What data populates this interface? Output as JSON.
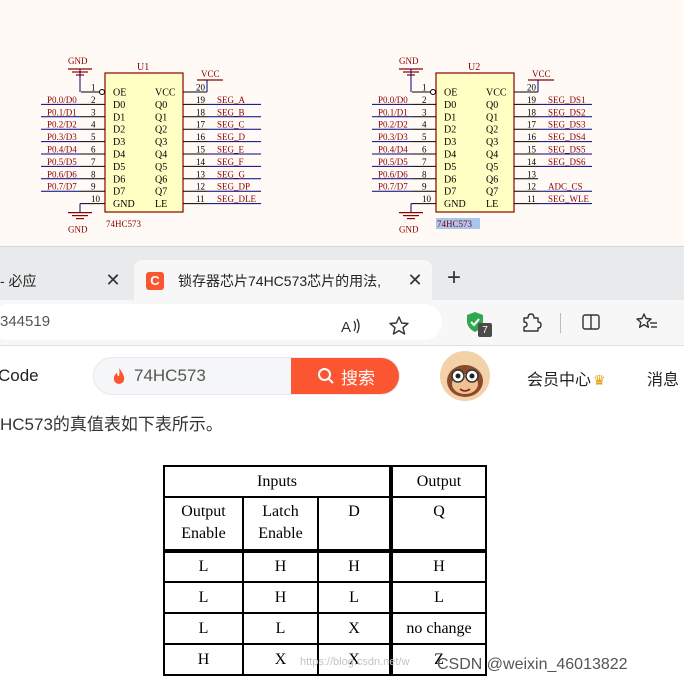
{
  "schematic": {
    "chips": [
      {
        "ref": "U1",
        "part": "74HC573",
        "left_pins": [
          {
            "num": "1",
            "name": "OE",
            "net": ""
          },
          {
            "num": "2",
            "name": "D0",
            "net": "P0.0/D0"
          },
          {
            "num": "3",
            "name": "D1",
            "net": "P0.1/D1"
          },
          {
            "num": "4",
            "name": "D2",
            "net": "P0.2/D2"
          },
          {
            "num": "5",
            "name": "D3",
            "net": "P0.3/D3"
          },
          {
            "num": "6",
            "name": "D4",
            "net": "P0.4/D4"
          },
          {
            "num": "7",
            "name": "D5",
            "net": "P0.5/D5"
          },
          {
            "num": "8",
            "name": "D6",
            "net": "P0.6/D6"
          },
          {
            "num": "9",
            "name": "D7",
            "net": "P0.7/D7"
          },
          {
            "num": "10",
            "name": "GND",
            "net": ""
          }
        ],
        "right_pins": [
          {
            "num": "20",
            "name": "VCC",
            "net": ""
          },
          {
            "num": "19",
            "name": "Q0",
            "net": "SEG_A"
          },
          {
            "num": "18",
            "name": "Q1",
            "net": "SEG_B"
          },
          {
            "num": "17",
            "name": "Q2",
            "net": "SEG_C"
          },
          {
            "num": "16",
            "name": "Q3",
            "net": "SEG_D"
          },
          {
            "num": "15",
            "name": "Q4",
            "net": "SEG_E"
          },
          {
            "num": "14",
            "name": "Q5",
            "net": "SEG_F"
          },
          {
            "num": "13",
            "name": "Q6",
            "net": "SEG_G"
          },
          {
            "num": "12",
            "name": "Q7",
            "net": "SEG_DP"
          },
          {
            "num": "11",
            "name": "LE",
            "net": "SEG_DLE"
          }
        ]
      },
      {
        "ref": "U2",
        "part": "74HC573",
        "left_pins": [
          {
            "num": "1",
            "name": "OE",
            "net": ""
          },
          {
            "num": "2",
            "name": "D0",
            "net": "P0.0/D0"
          },
          {
            "num": "3",
            "name": "D1",
            "net": "P0.1/D1"
          },
          {
            "num": "4",
            "name": "D2",
            "net": "P0.2/D2"
          },
          {
            "num": "5",
            "name": "D3",
            "net": "P0.3/D3"
          },
          {
            "num": "6",
            "name": "D4",
            "net": "P0.4/D4"
          },
          {
            "num": "7",
            "name": "D5",
            "net": "P0.5/D5"
          },
          {
            "num": "8",
            "name": "D6",
            "net": "P0.6/D6"
          },
          {
            "num": "9",
            "name": "D7",
            "net": "P0.7/D7"
          },
          {
            "num": "10",
            "name": "GND",
            "net": ""
          }
        ],
        "right_pins": [
          {
            "num": "20",
            "name": "VCC",
            "net": ""
          },
          {
            "num": "19",
            "name": "Q0",
            "net": "SEG_DS1"
          },
          {
            "num": "18",
            "name": "Q1",
            "net": "SEG_DS2"
          },
          {
            "num": "17",
            "name": "Q2",
            "net": "SEG_DS3"
          },
          {
            "num": "16",
            "name": "Q3",
            "net": "SEG_DS4"
          },
          {
            "num": "15",
            "name": "Q4",
            "net": "SEG_DS5"
          },
          {
            "num": "14",
            "name": "Q5",
            "net": "SEG_DS6"
          },
          {
            "num": "13",
            "name": "Q6",
            "net": ""
          },
          {
            "num": "12",
            "name": "Q7",
            "net": "ADC_CS"
          },
          {
            "num": "11",
            "name": "LE",
            "net": "SEG_WLE"
          }
        ]
      }
    ],
    "power_labels": {
      "gnd": "GND",
      "vcc": "VCC"
    },
    "colors": {
      "net_label": "#8b0000",
      "body_fill": "#ffffc4",
      "body_stroke": "#8b0000",
      "wire": "#000080",
      "selection": "#a9c7ee"
    }
  },
  "browser": {
    "tabs": [
      {
        "title": "- 必应",
        "active": false
      },
      {
        "title": "锁存器芯片74HC573芯片的用法,",
        "active": true
      }
    ],
    "favicon_letter": "C",
    "close_glyph": "✕",
    "new_tab_glyph": "+",
    "url_fragment": "344519",
    "extension_badge": "7"
  },
  "csdn": {
    "code_link": "Code",
    "search": {
      "value": "74HC573",
      "button_label": "搜索"
    },
    "vip_label": "会员中心",
    "messages_label": "消息"
  },
  "article": {
    "intro": "HC573的真值表如下表所示。",
    "table": {
      "group_headers": [
        "Inputs",
        "Output"
      ],
      "column_headers": [
        {
          "line1": "Output",
          "line2": "Enable"
        },
        {
          "line1": "Latch",
          "line2": "Enable"
        },
        {
          "line1": "D",
          "line2": ""
        },
        {
          "line1": "Q",
          "line2": ""
        }
      ],
      "rows": [
        [
          "L",
          "H",
          "H",
          "H"
        ],
        [
          "L",
          "H",
          "L",
          "L"
        ],
        [
          "L",
          "L",
          "X",
          "no change"
        ],
        [
          "H",
          "X",
          "X",
          "Z"
        ]
      ]
    },
    "watermark": "https://blog.csdn.net/w",
    "credit": "CSDN @weixin_46013822"
  }
}
